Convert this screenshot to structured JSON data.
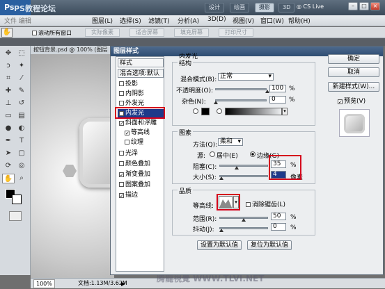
{
  "watermark_logo": "PS教程论坛",
  "app": {
    "top_buttons": [
      "设计",
      "绘画",
      "摄影",
      "3D"
    ],
    "cslive": "CS Live",
    "menu": [
      "图层(L)",
      "选择(S)",
      "滤镜(T)",
      "分析(A)",
      "3D(D)",
      "视图(V)",
      "窗口(W)",
      "帮助(H)"
    ],
    "option_checkbox": "滚动所有窗口",
    "option_buttons": [
      "实际像素",
      "适合屏幕",
      "填充屏幕",
      "打印尺寸"
    ]
  },
  "document": {
    "tab_title": "按钮背景.psd @ 100% (图层",
    "zoom": "100%",
    "doc_info": "文档:1.13M/3.62M"
  },
  "dialog": {
    "title": "图层样式",
    "styles_header": "样式",
    "blend_default": "混合选项:默认",
    "styles": [
      {
        "label": "投影",
        "checked": false
      },
      {
        "label": "内阴影",
        "checked": false
      },
      {
        "label": "外发光",
        "checked": false
      },
      {
        "label": "内发光",
        "checked": true
      },
      {
        "label": "斜面和浮雕",
        "checked": true
      },
      {
        "label": "等高线",
        "checked": true
      },
      {
        "label": "纹理",
        "checked": false
      },
      {
        "label": "光泽",
        "checked": false
      },
      {
        "label": "颜色叠加",
        "checked": false
      },
      {
        "label": "渐变叠加",
        "checked": true
      },
      {
        "label": "图案叠加",
        "checked": false
      },
      {
        "label": "描边",
        "checked": true
      }
    ],
    "section_title": "内发光",
    "structure": {
      "title": "结构",
      "blend_mode_label": "混合模式(B):",
      "blend_mode": "正常",
      "opacity_label": "不透明度(O):",
      "opacity": "100",
      "noise_label": "杂色(N):",
      "noise": "0",
      "percent": "%"
    },
    "elements": {
      "title": "图素",
      "method_label": "方法(Q):",
      "method": "柔和",
      "source_label": "源:",
      "source_center": "居中(E)",
      "source_edge": "边缘(G)",
      "choke_label": "阻塞(C):",
      "choke": "35",
      "size_label": "大小(S):",
      "size": "4",
      "pixels": "像素"
    },
    "quality": {
      "title": "品质",
      "contour_label": "等高线:",
      "antialias": "消除锯齿(L)",
      "range_label": "范围(R):",
      "range": "50",
      "jitter_label": "抖动(J):",
      "jitter": "0"
    },
    "buttons": {
      "set_default": "设置为默认值",
      "reset_default": "复位为默认值",
      "ok": "确定",
      "cancel": "取消",
      "new_style": "新建样式(W)...",
      "preview": "预览(V)"
    },
    "accent": "#d5001c",
    "selected_bg": "#1e3a8a"
  },
  "footer_watermark": "腾龍視覺 WWW.TLVI.NET"
}
